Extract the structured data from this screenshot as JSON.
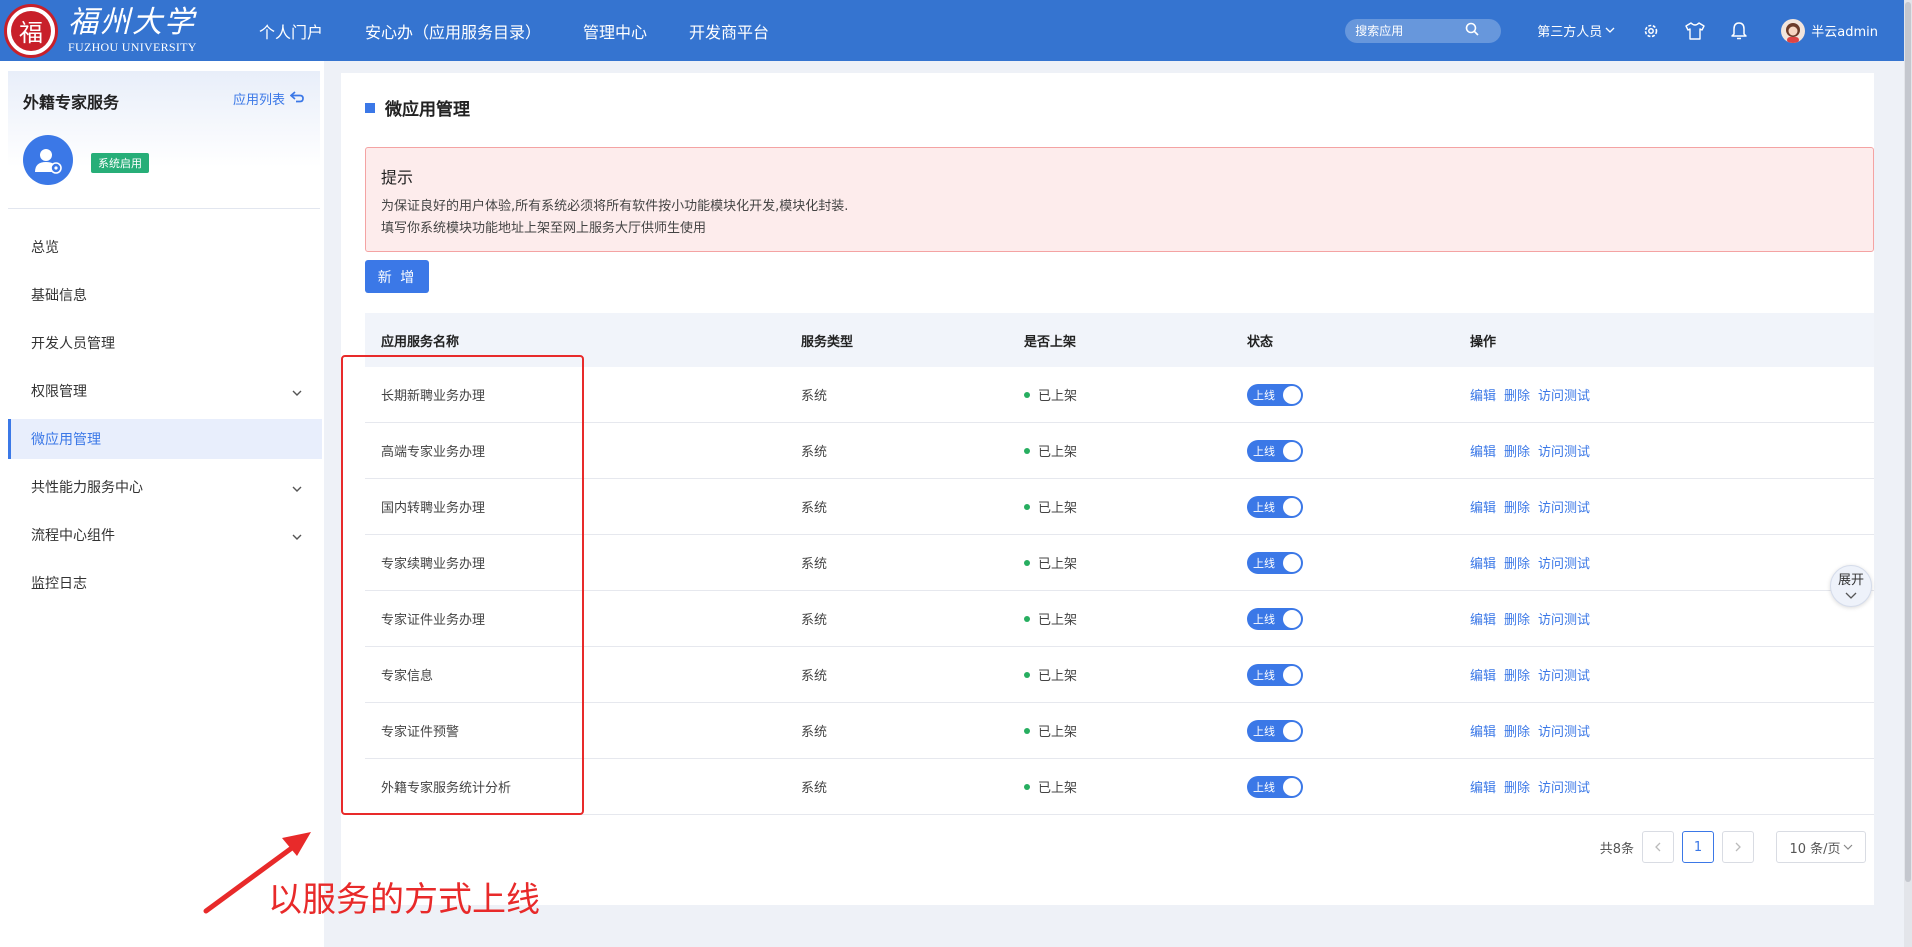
{
  "brand": {
    "seal_char": "福",
    "name_cn": "福州大学",
    "name_en": "FUZHOU UNIVERSITY"
  },
  "nav": [
    "个人门户",
    "安心办（应用服务目录）",
    "管理中心",
    "开发商平台"
  ],
  "header": {
    "search_placeholder": "搜索应用",
    "role": "第三方人员",
    "user": "半云admin",
    "icons": [
      "settings-gear-icon",
      "shirt-theme-icon",
      "bell-icon"
    ]
  },
  "sidebar": {
    "title": "外籍专家服务",
    "app_list_link": "应用列表",
    "status_badge": "系统启用",
    "items": [
      {
        "label": "总览"
      },
      {
        "label": "基础信息"
      },
      {
        "label": "开发人员管理"
      },
      {
        "label": "权限管理",
        "expandable": true
      },
      {
        "label": "微应用管理",
        "active": true
      },
      {
        "label": "共性能力服务中心",
        "expandable": true
      },
      {
        "label": "流程中心组件",
        "expandable": true
      },
      {
        "label": "监控日志"
      }
    ]
  },
  "main": {
    "title": "微应用管理",
    "notice": {
      "title": "提示",
      "line1": "为保证良好的用户体验,所有系统必须将所有软件按小功能模块化开发,模块化封装.",
      "line2": "填写你系统模块功能地址上架至网上服务大厅供师生使用"
    },
    "add_button": "新 增",
    "table": {
      "headers": [
        "应用服务名称",
        "服务类型",
        "是否上架",
        "状态",
        "操作"
      ],
      "rows": [
        {
          "name": "长期新聘业务办理",
          "type": "系统",
          "listed": "已上架",
          "status": "上线"
        },
        {
          "name": "高端专家业务办理",
          "type": "系统",
          "listed": "已上架",
          "status": "上线"
        },
        {
          "name": "国内转聘业务办理",
          "type": "系统",
          "listed": "已上架",
          "status": "上线"
        },
        {
          "name": "专家续聘业务办理",
          "type": "系统",
          "listed": "已上架",
          "status": "上线"
        },
        {
          "name": "专家证件业务办理",
          "type": "系统",
          "listed": "已上架",
          "status": "上线"
        },
        {
          "name": "专家信息",
          "type": "系统",
          "listed": "已上架",
          "status": "上线"
        },
        {
          "name": "专家证件预警",
          "type": "系统",
          "listed": "已上架",
          "status": "上线"
        },
        {
          "name": "外籍专家服务统计分析",
          "type": "系统",
          "listed": "已上架",
          "status": "上线"
        }
      ],
      "actions": [
        "编辑",
        "删除",
        "访问测试"
      ]
    },
    "pagination": {
      "total": "共8条",
      "current_page": "1",
      "page_size": "10 条/页"
    },
    "expand_button": "展开"
  },
  "annotation": {
    "text": "以服务的方式上线"
  },
  "colors": {
    "topbar": "#3574d0",
    "accent": "#3b78e7",
    "status_green": "#27ae60",
    "annotation_red": "#e82a2a"
  }
}
